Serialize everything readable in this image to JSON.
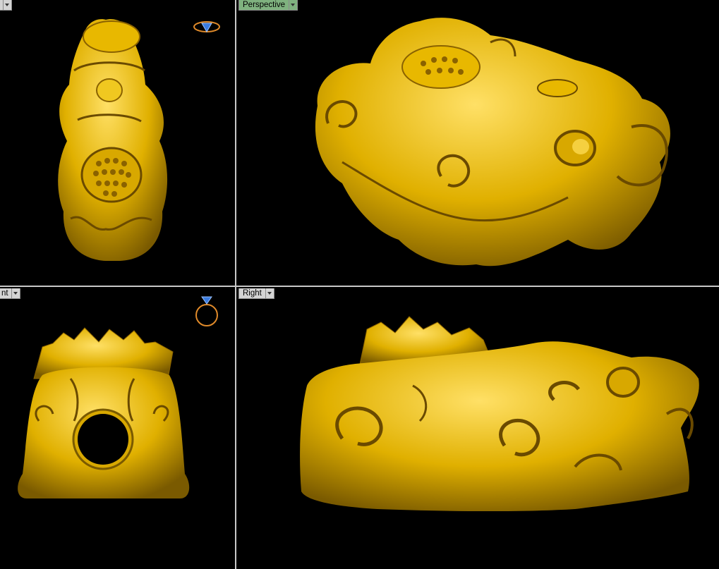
{
  "viewports": {
    "top": {
      "label": "",
      "gizmo": "ring-top-view-icon"
    },
    "perspective": {
      "label": "Perspective",
      "active": true
    },
    "front": {
      "label": "nt",
      "gizmo": "ring-front-view-icon"
    },
    "right": {
      "label": "Right"
    }
  },
  "colors": {
    "background": "#000000",
    "model_gold": "#e0b000",
    "model_shadow": "#7a5a00",
    "active_tab": "#7fb27f",
    "inactive_tab": "#d4d4d4",
    "separator": "#c8c8c8"
  }
}
